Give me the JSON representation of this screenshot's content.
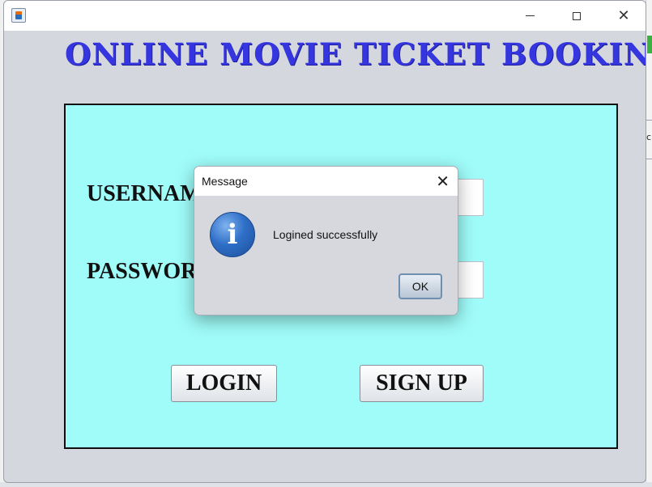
{
  "window": {
    "title": "",
    "controls": {
      "minimize_icon": "minimize-icon",
      "maximize_icon": "maximize-icon",
      "close_glyph": "✕"
    }
  },
  "header": {
    "title": "ONLINE MOVIE TICKET BOOKING"
  },
  "form": {
    "username_label": "USERNAME",
    "password_label": "PASSWORD",
    "username_value": "",
    "password_value": "",
    "login_label": "LOGIN",
    "signup_label": "SIGN UP"
  },
  "dialog": {
    "title": "Message",
    "close_glyph": "✕",
    "icon": "info-icon",
    "icon_glyph": "i",
    "message": "Logined successfully",
    "ok_label": "OK"
  },
  "background_fragment": {
    "text": "c"
  },
  "colors": {
    "title": "#3636e0",
    "panel": "#9ffcf9",
    "window_body": "#d4d7de",
    "dialog_body": "#d6d8de",
    "info_icon": "#2f6fc7"
  }
}
